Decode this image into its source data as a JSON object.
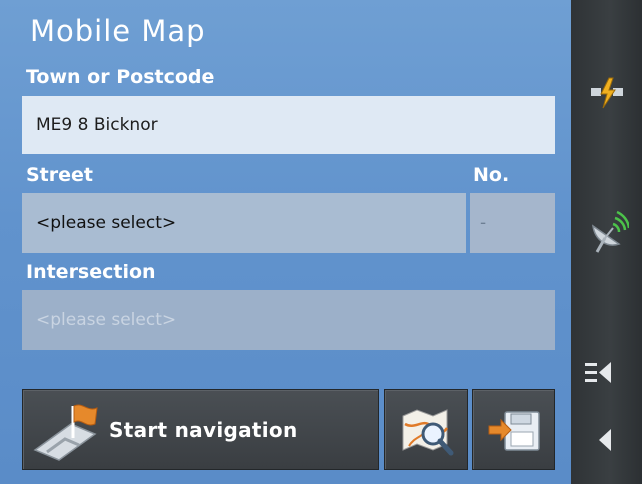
{
  "app": {
    "title": "Mobile Map"
  },
  "form": {
    "town_label": "Town or Postcode",
    "town_value": "ME9 8 Bicknor",
    "street_label": "Street",
    "street_value": "<please select>",
    "number_label": "No.",
    "number_value": "-",
    "intersection_label": "Intersection",
    "intersection_value": "<please select>"
  },
  "actions": {
    "start_navigation_label": "Start navigation"
  },
  "sidebar": {
    "icons": [
      "power-plug-icon",
      "satellite-dish-icon",
      "menu-collapse-icon",
      "back-arrow-icon"
    ]
  },
  "colors": {
    "background": "#6193cd",
    "rail": "#35393c",
    "button": "#43474b",
    "accent_orange": "#e6892b"
  }
}
